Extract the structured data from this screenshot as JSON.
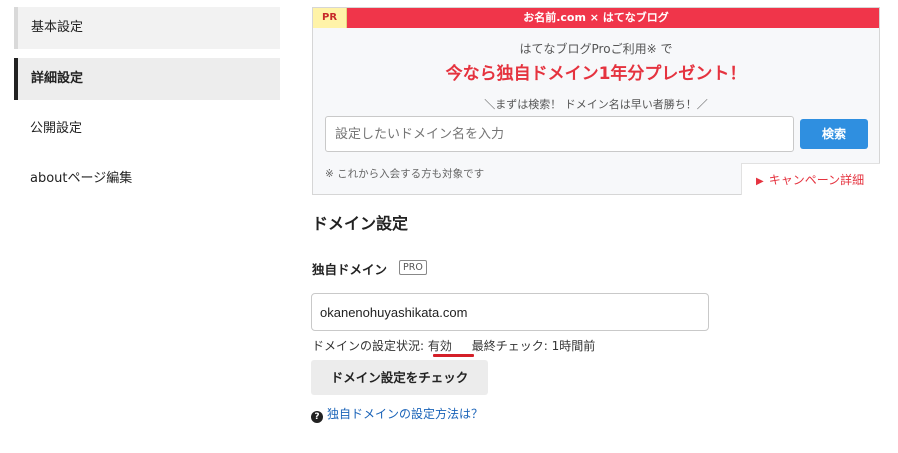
{
  "sidebar": {
    "items": [
      {
        "label": "基本設定"
      },
      {
        "label": "詳細設定"
      },
      {
        "label": "公開設定"
      },
      {
        "label": "aboutページ編集"
      }
    ]
  },
  "promo": {
    "pr_label": "PR",
    "brand": "お名前.com × はてなブログ",
    "line1": "はてなブログProご利用※ で",
    "headline": "今なら独自ドメイン1年分プレゼント！",
    "subline": "＼まずは検索！ ドメイン名は早い者勝ち！／",
    "search_placeholder": "設定したいドメイン名を入力",
    "search_button": "検索",
    "note": "※ これから入会する方も対象です",
    "detail_link": "キャンペーン詳細",
    "colors": {
      "accent": "#f0354a",
      "button": "#2f8fe0"
    }
  },
  "domain": {
    "title": "ドメイン設定",
    "field_label": "独自ドメイン",
    "pro_badge": "PRO",
    "value": "okanenohuyashikata.com",
    "status_label": "ドメインの設定状況:",
    "status_value": "有効",
    "last_check": "最終チェック: 1時間前",
    "check_button": "ドメイン設定をチェック",
    "help_link": "独自ドメインの設定方法は？",
    "help_icon": "question-circle-icon"
  }
}
